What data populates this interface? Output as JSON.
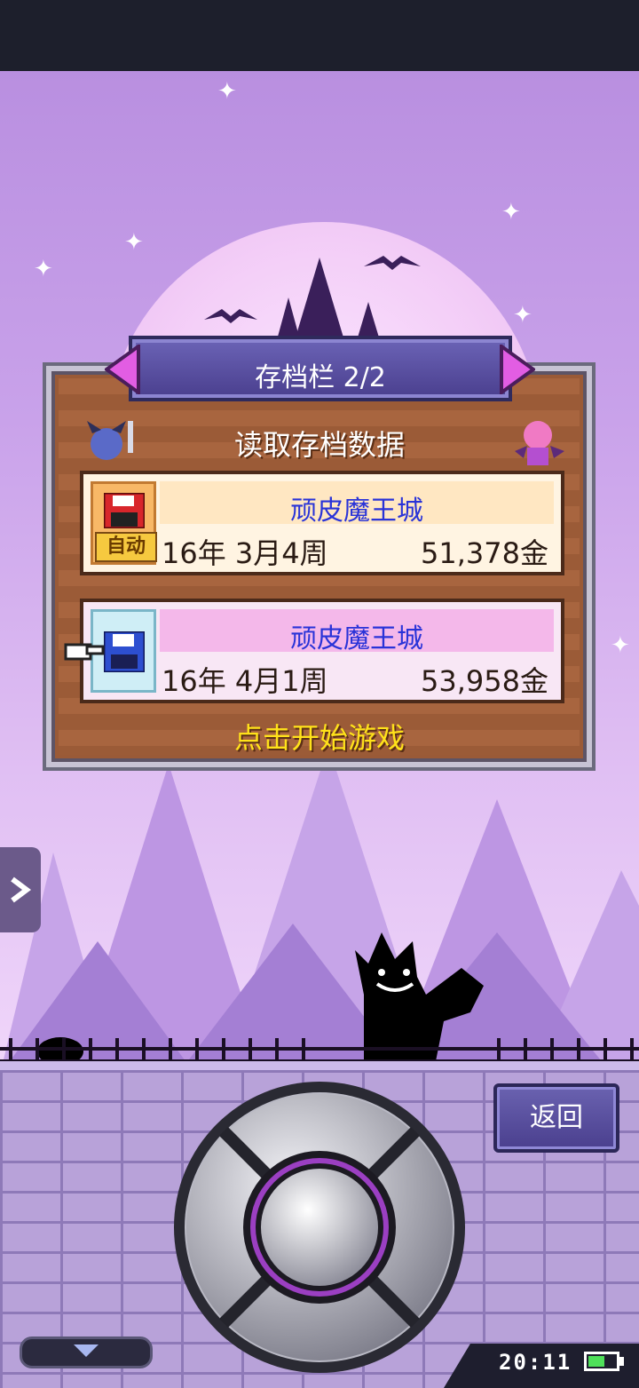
{
  "header": {
    "title": "存档栏 2/2"
  },
  "dialog": {
    "subtitle": "读取存档数据",
    "start_prompt": "点击开始游戏",
    "slots": [
      {
        "name": "顽皮魔王城",
        "date": "16年 3月4周",
        "gold": "51,378金",
        "auto_label": "自动",
        "icon": "floppy-disk-red-icon"
      },
      {
        "name": "顽皮魔王城",
        "date": "16年 4月1周",
        "gold": "53,958金",
        "icon": "floppy-disk-blue-icon"
      }
    ]
  },
  "buttons": {
    "back": "返回"
  },
  "status": {
    "clock": "20:11",
    "battery_level": 0.6
  },
  "colors": {
    "panel": "#9a5a37",
    "title_bar": "#4a3f8e",
    "accent_yellow": "#ffe21a",
    "slot_name": "#2933d8"
  }
}
